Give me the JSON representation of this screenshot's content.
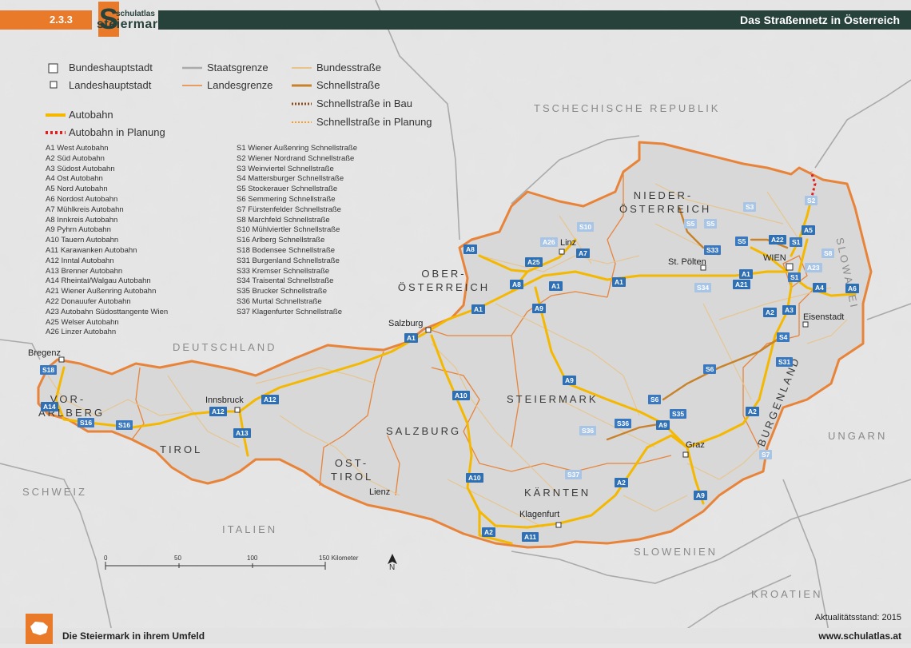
{
  "header": {
    "section_number": "2.3.3",
    "logo_top": "schulatlas",
    "logo_bottom": "steiermark",
    "logo_letter": "S",
    "title": "Das Straßennetz in Österreich"
  },
  "legend": {
    "bundeshauptstadt": "Bundeshauptstadt",
    "landeshauptstadt": "Landeshauptstadt",
    "staatsgrenze": "Staatsgrenze",
    "landesgrenze": "Landesgrenze",
    "bundesstrasse": "Bundesstraße",
    "schnellstrasse": "Schnellstraße",
    "schnellstrasse_bau": "Schnellstraße in Bau",
    "schnellstrasse_planung": "Schnellstraße in Planung",
    "autobahn": "Autobahn",
    "autobahn_planung": "Autobahn in Planung"
  },
  "autobahn_list": [
    "A1 West Autobahn",
    "A2 Süd Autobahn",
    "A3 Südost Autobahn",
    "A4 Ost Autobahn",
    "A5 Nord Autobahn",
    "A6 Nordost Autobahn",
    "A7 Mühlkreis Autobahn",
    "A8 Innkreis Autobahn",
    "A9 Pyhrn Autobahn",
    "A10 Tauern Autobahn",
    "A11 Karawanken Autobahn",
    "A12 Inntal Autobahn",
    "A13 Brenner Autobahn",
    "A14 Rheintal/Walgau Autobahn",
    "A21 Wiener Außenring Autobahn",
    "A22 Donauufer Autobahn",
    "A23 Autobahn Südosttangente Wien",
    "A25 Welser Autobahn",
    "A26 Linzer Autobahn"
  ],
  "schnellstrasse_list": [
    "S1 Wiener Außenring Schnellstraße",
    "S2 Wiener Nordrand Schnellstraße",
    "S3 Weinviertel Schnellstraße",
    "S4 Mattersburger Schnellstraße",
    "S5 Stockerauer Schnellstraße",
    "S6 Semmering Schnellstraße",
    "S7 Fürstenfelder Schnellstraße",
    "S8 Marchfeld Schnellstraße",
    "S10 Mühlviertler Schnellstraße",
    "S16 Arlberg Schnellstraße",
    "S18 Bodensee Schnellstraße",
    "S31 Burgenland Schnellstraße",
    "S33 Kremser Schnellstraße",
    "S34 Traisental Schnellstraße",
    "S35 Brucker Schnellstraße",
    "S36 Murtal Schnellstraße",
    "S37 Klagenfurter Schnellstraße"
  ],
  "countries": {
    "cz": "TSCHECHISCHE REPUBLIK",
    "sk": "SLOWAKEI",
    "de": "DEUTSCHLAND",
    "hu": "UNGARN",
    "ch": "SCHWEIZ",
    "it": "ITALIEN",
    "si": "SLOWENIEN",
    "hr": "KROATIEN"
  },
  "states": {
    "noe_1": "NIEDER-",
    "noe_2": "ÖSTERREICH",
    "ooe_1": "OBER-",
    "ooe_2": "ÖSTERREICH",
    "vbg_1": "VOR-",
    "vbg_2": "ARLBERG",
    "tirol": "TIROL",
    "salzburg": "SALZBURG",
    "osttirol_1": "OST-",
    "osttirol_2": "TIROL",
    "steiermark": "STEIERMARK",
    "kaernten": "KÄRNTEN",
    "burgenland": "BURGENLAND"
  },
  "cities": {
    "bregenz": "Bregenz",
    "innsbruck": "Innsbruck",
    "salzburg": "Salzburg",
    "linz": "Linz",
    "st_poelten": "St. Pölten",
    "wien": "WIEN",
    "eisenstadt": "Eisenstadt",
    "graz": "Graz",
    "klagenfurt": "Klagenfurt",
    "lienz": "Lienz"
  },
  "road_shields": {
    "a1a": "A1",
    "a1b": "A1",
    "a1c": "A1",
    "a1d": "A1",
    "a1e": "A1",
    "a2a": "A2",
    "a2b": "A2",
    "a2c": "A2",
    "a2d": "A2",
    "a3": "A3",
    "a4": "A4",
    "a5": "A5",
    "a6": "A6",
    "a7": "A7",
    "a8a": "A8",
    "a8b": "A8",
    "a9a": "A9",
    "a9b": "A9",
    "a9c": "A9",
    "a9d": "A9",
    "a10a": "A10",
    "a10b": "A10",
    "a11": "A11",
    "a12a": "A12",
    "a12b": "A12",
    "a13": "A13",
    "a14": "A14",
    "a21": "A21",
    "a22": "A22",
    "a23": "A23",
    "a25": "A25",
    "a26": "A26",
    "s1a": "S1",
    "s1b": "S1",
    "s2": "S2",
    "s3": "S3",
    "s4": "S4",
    "s5a": "S5",
    "s5b": "S5",
    "s6a": "S6",
    "s6b": "S6",
    "s7": "S7",
    "s8": "S8",
    "s10": "S10",
    "s16a": "S16",
    "s16b": "S16",
    "s18": "S18",
    "s31": "S31",
    "s33": "S33",
    "s34": "S34",
    "s35": "S35",
    "s36a": "S36",
    "s36b": "S36",
    "s37": "S37"
  },
  "scale": {
    "t0": "0",
    "t1": "50",
    "t2": "100",
    "t3": "150 Kilometer"
  },
  "north": "N",
  "footer": {
    "left": "Die Steiermark in ihrem Umfeld",
    "right": "www.schulatlas.at",
    "stand": "Aktualitätsstand: 2015"
  },
  "colors": {
    "autobahn": "#f5b800",
    "autobahn_casing": "#f7d874",
    "staatsgrenze": "#aaaaaa",
    "landesgrenze": "#e8843a",
    "bundesstrasse": "#e8c48a",
    "schnellstrasse": "#c8822a",
    "header_dark": "#27413b",
    "header_orange": "#e87a2a",
    "shield_blue": "#2f6fb3"
  }
}
